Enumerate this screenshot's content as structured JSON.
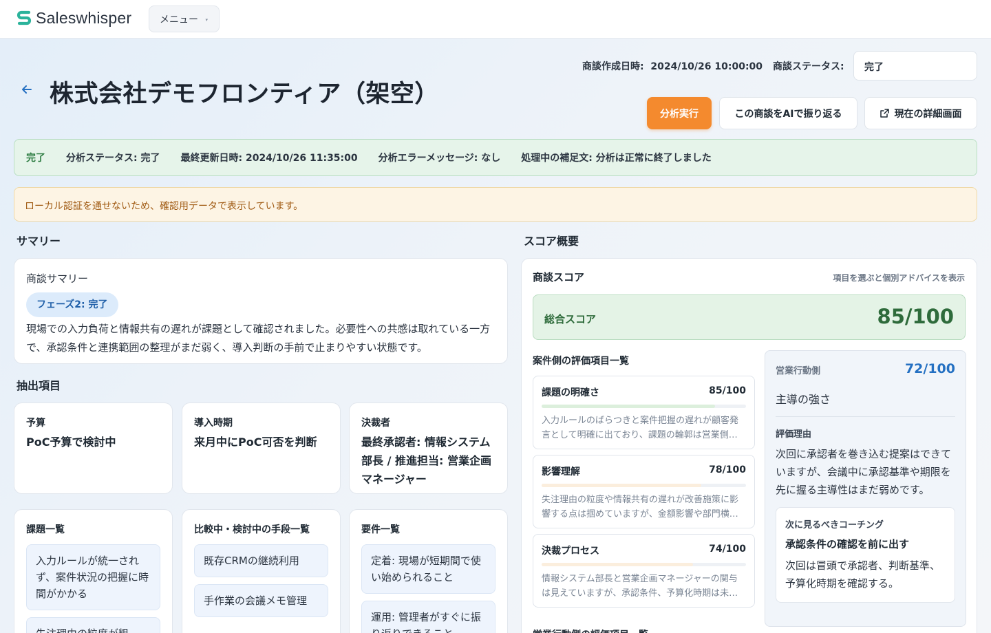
{
  "app": {
    "name": "Saleswhisper",
    "menu_label": "メニュー",
    "menu_caret": "▾"
  },
  "header": {
    "title": "株式会社デモフロンティア（架空）",
    "created_label": "商談作成日時:",
    "created_value": "2024/10/26 10:00:00",
    "status_label": "商談ステータス:",
    "status_value": "完了"
  },
  "actions": {
    "analyze": "分析実行",
    "ai_review": "この商談をAIで振り返る",
    "detail": "現在の詳細画面"
  },
  "status_bar": {
    "state": "完了",
    "analysis_status": "分析ステータス: 完了",
    "updated": "最終更新日時: 2024/10/26 11:35:00",
    "error": "分析エラーメッセージ: なし",
    "note": "処理中の補足文: 分析は正常に終了しました"
  },
  "notice": "ローカル認証を通せないため、確認用データで表示しています。",
  "summary": {
    "section_title": "サマリー",
    "label": "商談サマリー",
    "phase": "フェーズ2: 完了",
    "text": "現場での入力負荷と情報共有の遅れが課題として確認されました。必要性への共感は取れている一方で、承認条件と連携範囲の整理がまだ弱く、導入判断の手前で止まりやすい状態です。"
  },
  "extraction": {
    "section_title": "抽出項目",
    "items": [
      {
        "label": "予算",
        "value": "PoC予算で検討中"
      },
      {
        "label": "導入時期",
        "value": "来月中にPoC可否を判断"
      },
      {
        "label": "決裁者",
        "value": "最終承認者: 情報システム部長 / 推進担当: 営業企画マネージャー"
      }
    ],
    "lists": [
      {
        "title": "課題一覧",
        "items": [
          "入力ルールが統一されず、案件状況の把握に時間がかかる",
          "失注理由の粒度が粗"
        ]
      },
      {
        "title": "比較中・検討中の手段一覧",
        "items": [
          "既存CRMの継続利用",
          "手作業の会議メモ管理"
        ]
      },
      {
        "title": "要件一覧",
        "items": [
          "定着: 現場が短期間で使い始められること",
          "運用: 管理者がすぐに振り返りできること"
        ]
      }
    ]
  },
  "score": {
    "section_title": "スコア概要",
    "card_title": "商談スコア",
    "hint": "項目を選ぶと個別アドバイスを表示",
    "total_label": "総合スコア",
    "total_value": "85/100",
    "eval_title": "案件側の評価項目一覧",
    "eval_title2": "営業行動側の評価項目一覧",
    "items": [
      {
        "name": "課題の明確さ",
        "score": "85/100",
        "progress": 85,
        "color": "#dcefdc",
        "desc": "入力ルールのばらつきと案件把握の遅れが顧客発言として明確に出ており、課題の輪郭は営業側でも把握できています。"
      },
      {
        "name": "影響理解",
        "score": "78/100",
        "progress": 78,
        "color": "#fbeedd",
        "desc": "失注理由の粒度や情報共有の遅れが改善施策に影響する点は掴めていますが、金額影響や部門横断の影響はまだ曖昧です。"
      },
      {
        "name": "決裁プロセス",
        "score": "74/100",
        "progress": 74,
        "color": "#fbeedd",
        "desc": "情報システム部長と営業企画マネージャーの関与は見えていますが、承認条件、予算化時期は未確認です。"
      }
    ],
    "sales": {
      "label": "営業行動側",
      "score": "72/100",
      "sub": "主導の強さ",
      "reason_label": "評価理由",
      "reason": "次回に承認者を巻き込む提案はできていますが、会議中に承認基準や期限を先に握る主導性はまだ弱めです。",
      "coach_label": "次に見るべきコーチング",
      "coach_title": "承認条件の確認を前に出す",
      "coach_text": "次回は冒頭で承認者、判断基準、予算化時期を確認する。"
    }
  },
  "colors": {
    "accent": "#f48a2e",
    "success": "#2e7d43",
    "link": "#2470c2",
    "brand": "#2bb39b"
  }
}
